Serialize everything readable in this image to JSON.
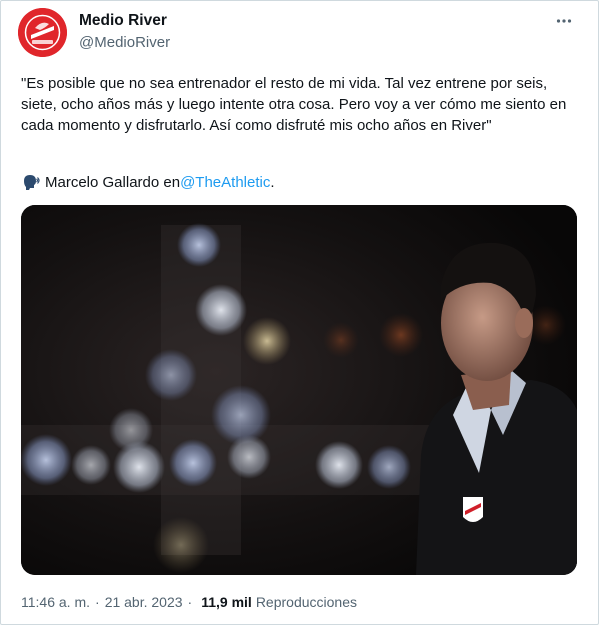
{
  "account": {
    "display_name": "Medio River",
    "handle": "@MedioRiver",
    "avatar_icon": "river-plate-logo-icon",
    "avatar_color": "#e0262b"
  },
  "tweet": {
    "text": "\"Es posible que no sea entrenador el resto de mi vida. Tal vez entrene por seis, siete, ocho años más y luego intente otra cosa. Pero voy a ver cómo me siento en cada momento y disfrutarlo. Así como disfruté mis ocho años en River\"",
    "byline_prefix": "Marcelo Gallardo en ",
    "byline_mention": "@TheAthletic",
    "byline_suffix": ".",
    "byline_icon": "speaking-head-icon",
    "mention_color": "#1d9bf0"
  },
  "media": {
    "image_icon": "photo-marcelo-gallardo"
  },
  "meta": {
    "time": "11:46 a. m.",
    "separator_1": "·",
    "date": "21 abr. 2023",
    "separator_2": "·",
    "views_count": "11,9 mil",
    "views_label": "Reproducciones"
  },
  "menu": {
    "more_icon": "more-options-icon"
  }
}
